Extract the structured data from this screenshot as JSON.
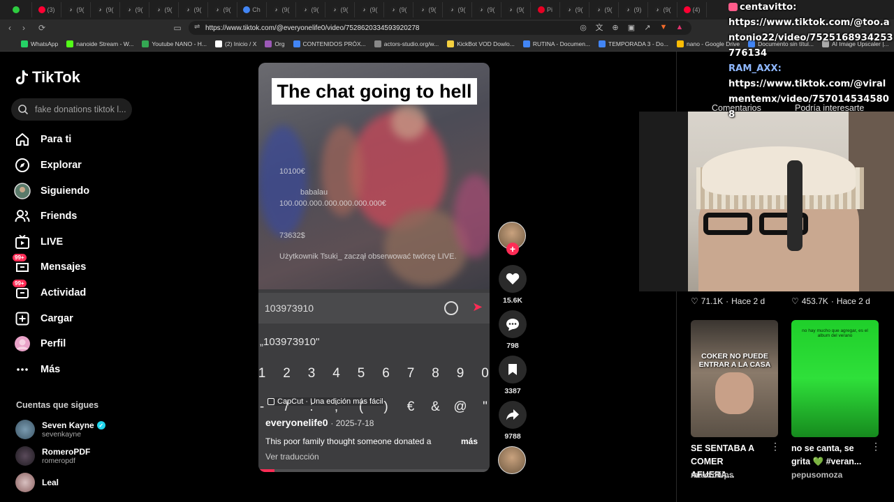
{
  "browser": {
    "tabs": [
      {
        "icon": "x",
        "label": ""
      },
      {
        "icon": "youtube",
        "label": "(3)"
      },
      {
        "icon": "tiktok",
        "label": "(9("
      },
      {
        "icon": "tiktok",
        "label": "(9("
      },
      {
        "icon": "tiktok",
        "label": "(9("
      },
      {
        "icon": "tiktok",
        "label": "(9("
      },
      {
        "icon": "tiktok",
        "label": "(9("
      },
      {
        "icon": "tiktok",
        "label": "(9("
      },
      {
        "icon": "chrome",
        "label": "Ch"
      },
      {
        "icon": "tiktok",
        "label": "(9("
      },
      {
        "icon": "tiktok",
        "label": "(9("
      },
      {
        "icon": "tiktok",
        "label": "(9("
      },
      {
        "icon": "tiktok",
        "label": "(9("
      },
      {
        "icon": "tiktok",
        "label": "(9("
      },
      {
        "icon": "tiktok",
        "label": "(9("
      },
      {
        "icon": "tiktok",
        "label": "(9("
      },
      {
        "icon": "tiktok",
        "label": "(9("
      },
      {
        "icon": "tiktok",
        "label": "(9("
      },
      {
        "icon": "pinterest",
        "label": "Pi"
      },
      {
        "icon": "tiktok",
        "label": "(9("
      },
      {
        "icon": "tiktok",
        "label": "(9("
      },
      {
        "icon": "tiktok",
        "label": "(9)"
      },
      {
        "icon": "tiktok",
        "label": "(9("
      },
      {
        "icon": "youtube",
        "label": "(4)"
      }
    ],
    "url": "https://www.tiktok.com/@everyonelife0/video/7528620334593920278",
    "bookmarks": [
      {
        "label": "WhatsApp",
        "color": "#25d366"
      },
      {
        "label": "nanoide Stream - W...",
        "color": "#53fc18"
      },
      {
        "label": "Youtube NANO - H...",
        "color": "#34a853"
      },
      {
        "label": "(2) Inicio / X",
        "color": "#ffffff"
      },
      {
        "label": "Org",
        "color": "#9b59b6"
      },
      {
        "label": "CONTENIDOS PRÓX...",
        "color": "#4285f4"
      },
      {
        "label": "actors-studio.org/w...",
        "color": "#888888"
      },
      {
        "label": "KickBot VOD Dowlo...",
        "color": "#f4d03f"
      },
      {
        "label": "RUTINA - Documen...",
        "color": "#4285f4"
      },
      {
        "label": "TEMPORADA 3 - Do...",
        "color": "#4285f4"
      },
      {
        "label": "nano - Google Drive",
        "color": "#fbbc04"
      },
      {
        "label": "Documento sin títul...",
        "color": "#4285f4"
      },
      {
        "label": "AI Image Upscaler |...",
        "color": "#aaaaaa"
      }
    ]
  },
  "sidebar": {
    "logo": "TikTok",
    "search_placeholder": "fake donations tiktok l...",
    "items": [
      {
        "label": "Para ti",
        "icon": "home-icon",
        "badge": ""
      },
      {
        "label": "Explorar",
        "icon": "compass-icon",
        "badge": ""
      },
      {
        "label": "Siguiendo",
        "icon": "following-avatar-icon",
        "badge": ""
      },
      {
        "label": "Friends",
        "icon": "friends-icon",
        "badge": ""
      },
      {
        "label": "LIVE",
        "icon": "live-icon",
        "badge": ""
      },
      {
        "label": "Mensajes",
        "icon": "message-icon",
        "badge": "99+"
      },
      {
        "label": "Actividad",
        "icon": "activity-icon",
        "badge": "99+"
      },
      {
        "label": "Cargar",
        "icon": "upload-icon",
        "badge": ""
      },
      {
        "label": "Perfil",
        "icon": "profile-avatar-icon",
        "badge": ""
      },
      {
        "label": "Más",
        "icon": "more-icon",
        "badge": ""
      }
    ],
    "following_title": "Cuentas que sigues",
    "accounts": [
      {
        "name": "Seven Kayne",
        "user": "sevenkayne",
        "verified": true
      },
      {
        "name": "RomeroPDF",
        "user": "romeropdf",
        "verified": false
      },
      {
        "name": "Leal",
        "user": "",
        "verified": false
      }
    ]
  },
  "video": {
    "caption": "The chat going to hell",
    "overlays": [
      "10100€",
      "babalau",
      "100.000.000.000.000.000.000€",
      "73632$",
      "Użytkownik Tsuki_ zaczął obserwować twórcę LIVE."
    ],
    "input_value": "103973910",
    "suggestion": "„103973910\"",
    "keys": [
      "1",
      "2",
      "3",
      "4",
      "5",
      "6",
      "7",
      "8",
      "9",
      "0"
    ],
    "keys2": [
      "-",
      "/",
      ":",
      ";",
      "(",
      ")",
      "€",
      "&",
      "@",
      "\""
    ],
    "capcut": "CapCut · Una edición más fácil",
    "author": "everyonelife0",
    "date": "· 2025-7-18",
    "description": "This poor family thought someone donated a",
    "more": "más",
    "translate": "Ver traducción",
    "progress": 0.07
  },
  "actions": {
    "likes": "15.6K",
    "comments": "798",
    "saves": "3387",
    "shares": "9788"
  },
  "right_panel": {
    "tabs": [
      "Comentarios",
      "Podría interesarte"
    ],
    "meta": [
      {
        "likes": "71.1K",
        "when": "Hace 2 d"
      },
      {
        "likes": "453.7K",
        "when": "Hace 2 d"
      }
    ],
    "cards": [
      {
        "title": "SE SENTABA A COMER AFUERA...",
        "user": "maxxcliips",
        "thumb_text": "COKER NO PUEDE ENTRAR A LA CASA"
      },
      {
        "title": "no se canta, se grita 💚 #veran...",
        "user": "pepusomoza",
        "thumb_text": "no hay mucho que agregar, es el album del verano"
      }
    ]
  },
  "chat_overlay": {
    "user1": "centavitto:",
    "msg1": "https://www.tiktok.com/@too.antonio22/video/7525168934253776134",
    "user2": "RAM_AXX:",
    "msg2": "https://www.tiktok.com/@viralmentemx/video/7570145345808"
  }
}
